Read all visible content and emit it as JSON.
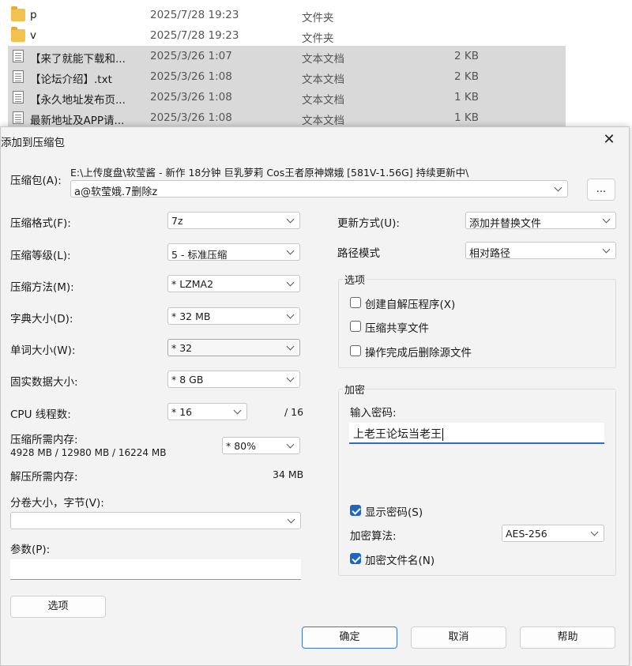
{
  "explorer": {
    "rows": [
      {
        "name": "p",
        "date": "2025/7/28 19:23",
        "type": "文件夹",
        "size": "",
        "icon": "folder-icon",
        "selected": false
      },
      {
        "name": "v",
        "date": "2025/7/28 19:23",
        "type": "文件夹",
        "size": "",
        "icon": "folder-icon",
        "selected": false
      },
      {
        "name": "【来了就能下载和...",
        "date": "2025/3/26 1:07",
        "type": "文本文档",
        "size": "2 KB",
        "icon": "text-file-icon",
        "selected": true
      },
      {
        "name": "【论坛介绍】.txt",
        "date": "2025/3/26 1:08",
        "type": "文本文档",
        "size": "2 KB",
        "icon": "text-file-icon",
        "selected": true
      },
      {
        "name": "【永久地址发布页...",
        "date": "2025/3/26 1:08",
        "type": "文本文档",
        "size": "1 KB",
        "icon": "text-file-icon",
        "selected": true
      },
      {
        "name": "最新地址及APP请...",
        "date": "2025/3/26 1:08",
        "type": "文本文档",
        "size": "1 KB",
        "icon": "text-file-icon",
        "selected": true
      }
    ]
  },
  "dialog": {
    "title": "添加到压缩包",
    "archive_label": "压缩包(A):",
    "archive_path": "E:\\上传度盘\\软莹酱 - 新作 18分钟 巨乳萝莉 Cos王者原神嫦娥 [581V-1.56G] 持续更新中\\",
    "archive_name": "a@软莹娥.7删除z",
    "browse_label": "...",
    "left": {
      "format_label": "压缩格式(F):",
      "format_value": "7z",
      "level_label": "压缩等级(L):",
      "level_value": "5 - 标准压缩",
      "method_label": "压缩方法(M):",
      "method_value": "* LZMA2",
      "dict_label": "字典大小(D):",
      "dict_value": "* 32 MB",
      "word_label": "单词大小(W):",
      "word_value": "* 32",
      "solid_label": "固实数据大小:",
      "solid_value": "* 8 GB",
      "cpu_label": "CPU 线程数:",
      "cpu_value": "* 16",
      "cpu_total": "/ 16",
      "mem_label": "压缩所需内存:",
      "mem_detail": "4928 MB / 12980 MB / 16224 MB",
      "mem_value": "* 80%",
      "decomp_label": "解压所需内存:",
      "decomp_value": "34 MB",
      "split_label": "分卷大小，字节(V):",
      "split_value": "",
      "params_label": "参数(P):",
      "params_value": "",
      "options_button": "选项"
    },
    "right": {
      "update_label": "更新方式(U):",
      "update_value": "添加并替换文件",
      "path_label": "路径模式",
      "path_value": "相对路径",
      "options_group": "选项",
      "opt_sfx": "创建自解压程序(X)",
      "opt_sfx_checked": false,
      "opt_shared": "压缩共享文件",
      "opt_shared_checked": false,
      "opt_delete": "操作完成后删除源文件",
      "opt_delete_checked": false,
      "enc_group": "加密",
      "pwd_label": "输入密码:",
      "pwd_value": "上老王论坛当老王",
      "show_pwd": "显示密码(S)",
      "show_pwd_checked": true,
      "enc_method_label": "加密算法:",
      "enc_method_value": "AES-256",
      "enc_names": "加密文件名(N)",
      "enc_names_checked": true
    },
    "ok_button": "确定",
    "cancel_button": "取消",
    "help_button": "帮助"
  }
}
